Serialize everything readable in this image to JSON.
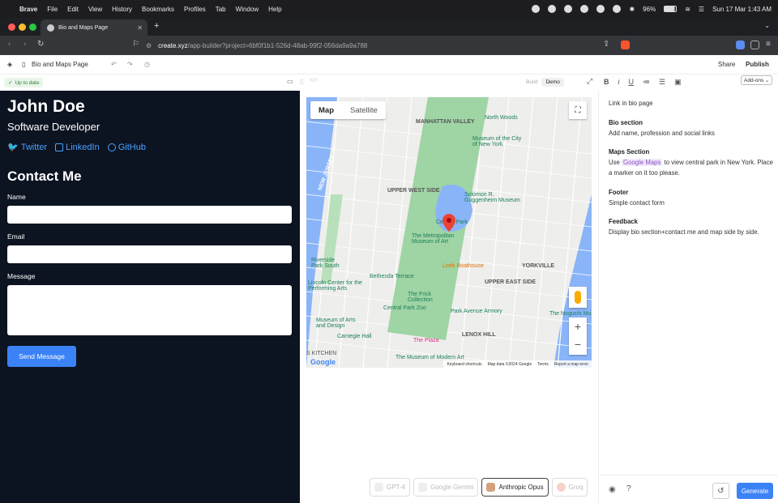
{
  "menubar": {
    "apple": "",
    "items": [
      "Brave",
      "File",
      "Edit",
      "View",
      "History",
      "Bookmarks",
      "Profiles",
      "Tab",
      "Window",
      "Help"
    ],
    "battery": "96%",
    "datetime": "Sun 17 Mar  1:43 AM"
  },
  "browser": {
    "tab_title": "Bio and Maps Page",
    "url_host": "create.xyz",
    "url_path": "/app-builder?project=6bf0f1b1-526d-48ab-99f2-056da9a9a788",
    "shield_count": "9"
  },
  "app": {
    "page_name": "Bio and Maps Page",
    "share": "Share",
    "publish": "Publish",
    "status": "Up to date",
    "mode_build": "Build",
    "mode_demo": "Demo",
    "addons": "Add-ons"
  },
  "preview": {
    "name": "John Doe",
    "role": "Software Developer",
    "links": [
      "Twitter",
      "LinkedIn",
      "GitHub"
    ],
    "contact_title": "Contact Me",
    "label_name": "Name",
    "label_email": "Email",
    "label_message": "Message",
    "send_button": "Send Message"
  },
  "map": {
    "type_map": "Map",
    "type_satellite": "Satellite",
    "attribution": [
      "Keyboard shortcuts",
      "Map data ©2024 Google",
      "Terms",
      "Report a map error"
    ],
    "google": "Google",
    "labels": [
      "MANHATTAN VALLEY",
      "UPPER WEST SIDE",
      "UPPER EAST SIDE",
      "YORKVILLE",
      "LENOX HILL",
      "NEW JERSEY",
      "Riverside Park South",
      "S KITCHEN"
    ],
    "places": [
      "Museum of the City of New York",
      "North Woods",
      "Solomon R. Guggenheim Museum",
      "Central Park",
      "The Metropolitan Museum of Art",
      "Loeb Boathouse",
      "Bethesda Terrace",
      "The Frick Collection",
      "Central Park Zoo",
      "Park Avenue Armory",
      "Lincoln Center for the Performing Arts",
      "Museum of Arts and Design",
      "Carnegie Hall",
      "The Plaza",
      "The Museum of Modern Art",
      "The Noguchi Mu"
    ]
  },
  "models": [
    "GPT-4",
    "Google Gemini",
    "Anthropic Opus",
    "Groq"
  ],
  "notes": {
    "intro": "Link in bio page",
    "bio_h": "Bio section",
    "bio_t": "Add name, profession and social links",
    "maps_h": "Maps Section",
    "maps_pre": "Use ",
    "maps_chip": "Google Maps",
    "maps_post": " to view central park in New York. Place a marker on it too please.",
    "footer_h": "Footer",
    "footer_t": "Simple contact form",
    "feedback_h": "Feedback",
    "feedback_t": "Display bio section+contact me and map side by side."
  },
  "generate": "Generate"
}
